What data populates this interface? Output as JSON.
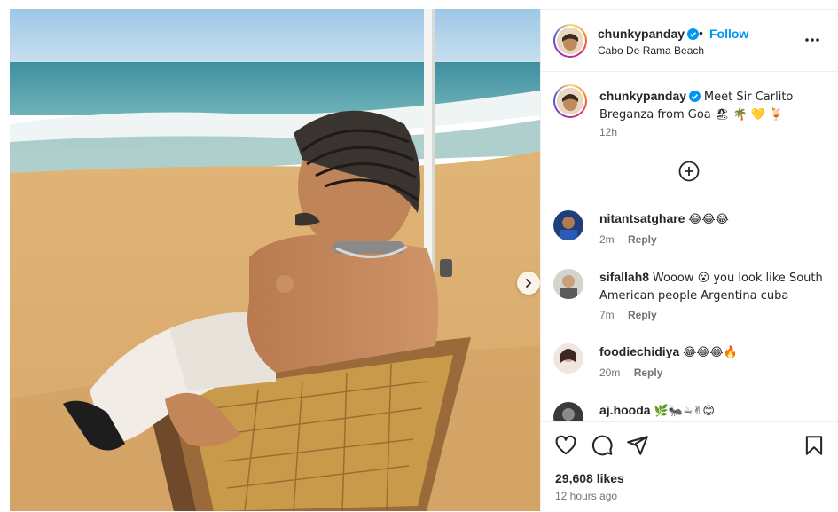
{
  "post": {
    "username": "chunkypanday",
    "dot": "•",
    "follow_label": "Follow",
    "location": "Cabo De Rama Beach",
    "caption": "Meet Sir Carlito Breganza from Goa 🏖 🌴 💛 🍹",
    "caption_time": "12h",
    "likes": "29,608 likes",
    "time_ago": "12 hours ago"
  },
  "comments": [
    {
      "username": "nitantsatghare",
      "text": "😂😂😂",
      "time": "2m",
      "reply": "Reply"
    },
    {
      "username": "sifallah8",
      "text": "Wooow 😮 you look like South American people Argentina cuba",
      "time": "7m",
      "reply": "Reply"
    },
    {
      "username": "foodiechidiya",
      "text": "😂😂😂🔥",
      "time": "20m",
      "reply": "Reply"
    },
    {
      "username": "aj.hooda",
      "text": "🌿🐜☕✌😊",
      "time": "",
      "reply": ""
    }
  ],
  "icons": {
    "verified": "verified-badge-icon",
    "more": "more-options-icon",
    "load_more": "plus-circle-icon",
    "like": "heart-icon",
    "comment": "comment-icon",
    "share": "share-icon",
    "save": "bookmark-icon",
    "next": "chevron-right-icon"
  },
  "colors": {
    "accent": "#0095f6",
    "text": "#262626",
    "muted": "#737373",
    "border": "#efefef"
  }
}
